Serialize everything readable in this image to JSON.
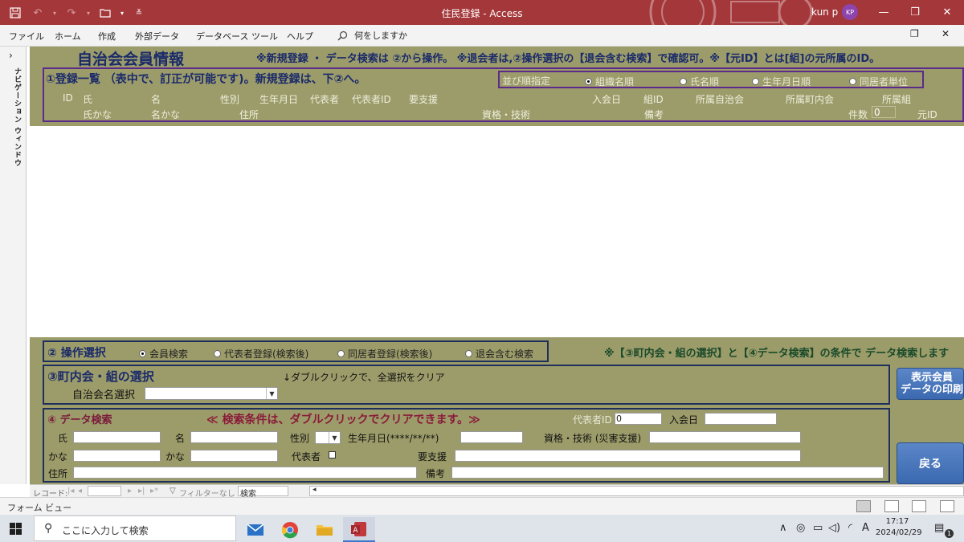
{
  "window": {
    "title": "住民登録 - Access",
    "user_name": "kun p",
    "user_initials": "KP"
  },
  "menu": {
    "items": [
      "ファイル",
      "ホーム",
      "作成",
      "外部データ",
      "データベース ツール",
      "ヘルプ"
    ],
    "search_placeholder": "何をしますか"
  },
  "nav_pane": {
    "label": "ナビゲーション ウィンドウ"
  },
  "form": {
    "title": "自治会会員情報",
    "header_note": "※新規登録 ・ データ検索は ②から操作。 ※退会者は,②操作選択の【退会含む検索】で確認可。※【元ID】とは[組]の元所属のID。",
    "list": {
      "title": "①登録一覧 （表中で、訂正が可能です)。新規登録は、下②へ。",
      "sort_label": "並び順指定",
      "sort_options": [
        "組織名順",
        "氏名順",
        "生年月日順",
        "同居者単位"
      ],
      "sort_selected": 0,
      "columns_row1": [
        "ID",
        "氏",
        "名",
        "性別",
        "生年月日",
        "代表者",
        "代表者ID",
        "要支援",
        "入会日",
        "組ID",
        "所属自治会",
        "所属町内会",
        "所属組"
      ],
      "columns_row2": [
        "氏かな",
        "名かな",
        "住所",
        "資格・技術",
        "備考",
        "件数",
        "元ID"
      ],
      "count_value": "0"
    },
    "ops": {
      "title": "② 操作選択",
      "options": [
        "会員検索",
        "代表者登録(検索後)",
        "同居者登録(検索後)",
        "退会含む検索"
      ],
      "selected": 0,
      "note": "※【③町内会・組の選択】と【④データ検索】の条件で データ検索します"
    },
    "section3": {
      "title": "③町内会・組の選択",
      "hint": "↓ダブルクリックで、全選択をクリア",
      "combo_label": "自治会名選択",
      "combo_value": ""
    },
    "print_button": "表示会員\nデータの印刷",
    "back_button": "戻る",
    "section4": {
      "title": "④ データ検索",
      "note": "≪ 検索条件は、ダブルクリックでクリアできます。≫",
      "rep_id_label": "代表者ID",
      "rep_id_value": "0",
      "join_date_label": "入会日",
      "surname_label": "氏",
      "given_label": "名",
      "gender_label": "性別",
      "dob_label": "生年月日(****/**/**)",
      "skills_label": "資格・技術 (災害支援)",
      "kana1_label": "かな",
      "kana2_label": "かな",
      "rep_label": "代表者",
      "support_label": "要支援",
      "address_label": "住所",
      "remarks_label": "備考"
    }
  },
  "record_nav": {
    "label": "レコード:",
    "filter": "フィルターなし",
    "search": "検索"
  },
  "statusbar": {
    "text": "フォーム ビュー"
  },
  "taskbar": {
    "search_placeholder": "ここに入力して検索",
    "time": "17:17",
    "date": "2024/02/29",
    "ime": "A",
    "notification_count": "1"
  }
}
